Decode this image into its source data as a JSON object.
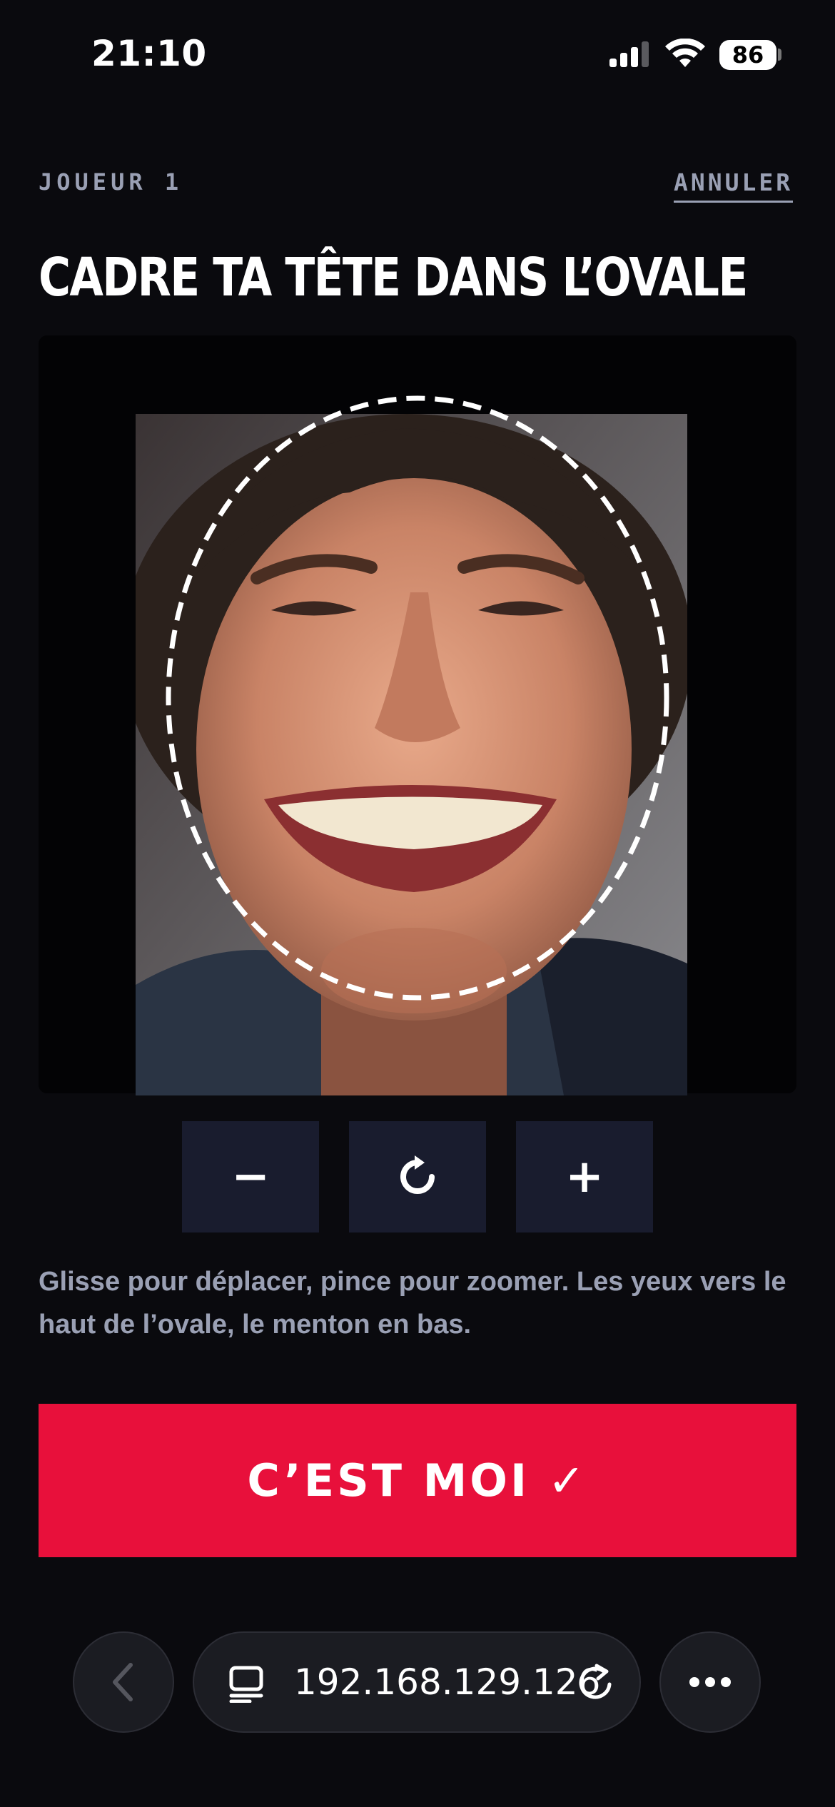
{
  "status_bar": {
    "time": "21:10",
    "battery": "86"
  },
  "header": {
    "player": "JOUEUR 1",
    "cancel": "ANNULER"
  },
  "title": "CADRE TA TÊTE DANS L’OVALE",
  "controls": {
    "zoom_out": "−",
    "zoom_in": "+"
  },
  "hint": "Glisse pour déplacer, pince pour zoomer. Les yeux vers le haut de l’ovale, le menton en bas.",
  "confirm_button": "C’EST MOI ✓",
  "browser": {
    "url": "192.168.129.126"
  },
  "colors": {
    "background": "#0a0a0e",
    "accent": "#e8103b",
    "control_bg": "#191c2e",
    "muted_text": "#9aa0b4"
  },
  "icons": [
    "signal-icon",
    "wifi-icon",
    "rotate-reset-icon",
    "back-chevron-icon",
    "document-icon",
    "reload-icon",
    "more-icon"
  ]
}
